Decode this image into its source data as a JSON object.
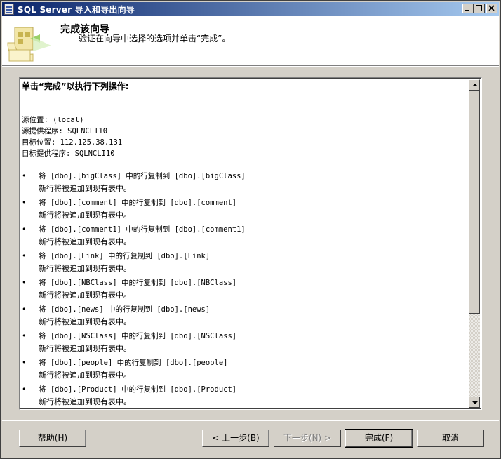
{
  "window": {
    "title": "SQL Server 导入和导出向导",
    "controls": {
      "minimize": "minimize",
      "maximize": "maximize",
      "close": "close"
    }
  },
  "header": {
    "title": "完成该向导",
    "subtitle": "验证在向导中选择的选项并单击“完成”。"
  },
  "summary": {
    "heading": "单击“完成”以执行下列操作:",
    "source_location": "源位置: (local)",
    "source_provider": "源提供程序: SQLNCLI10",
    "target_location": "目标位置: 112.125.38.131",
    "target_provider": "目标提供程序: SQLNCLI10",
    "bullet": "•",
    "items": [
      {
        "copy": "将 [dbo].[bigClass] 中的行复制到 [dbo].[bigClass]",
        "note": "新行将被追加到现有表中。"
      },
      {
        "copy": "将 [dbo].[comment] 中的行复制到 [dbo].[comment]",
        "note": "新行将被追加到现有表中。"
      },
      {
        "copy": "将 [dbo].[comment1] 中的行复制到 [dbo].[comment1]",
        "note": "新行将被追加到现有表中。"
      },
      {
        "copy": "将 [dbo].[Link] 中的行复制到 [dbo].[Link]",
        "note": "新行将被追加到现有表中。"
      },
      {
        "copy": "将 [dbo].[NBClass] 中的行复制到 [dbo].[NBClass]",
        "note": "新行将被追加到现有表中。"
      },
      {
        "copy": "将 [dbo].[news] 中的行复制到 [dbo].[news]",
        "note": "新行将被追加到现有表中。"
      },
      {
        "copy": "将 [dbo].[NSClass] 中的行复制到 [dbo].[NSClass]",
        "note": "新行将被追加到现有表中。"
      },
      {
        "copy": "将 [dbo].[people] 中的行复制到 [dbo].[people]",
        "note": "新行将被追加到现有表中。"
      },
      {
        "copy": "将 [dbo].[Product] 中的行复制到 [dbo].[Product]",
        "note": "新行将被追加到现有表中。"
      }
    ]
  },
  "buttons": {
    "help": "帮助(H)",
    "back": "< 上一步(B)",
    "next": "下一步(N) >",
    "finish": "完成(F)",
    "cancel": "取消"
  },
  "colors": {
    "title_bar_start": "#0a246a",
    "title_bar_end": "#a6caf0",
    "dialog_face": "#d4d0c8"
  },
  "icons": {
    "title": "app-icon",
    "wizard": "wizard-icon"
  }
}
